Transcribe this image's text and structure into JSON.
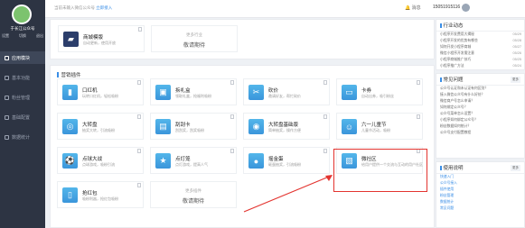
{
  "sidebar": {
    "brand": "于长江公众号",
    "settings": "设置",
    "switch": "切换",
    "exit": "退出",
    "items": [
      {
        "label": "应用模块",
        "active": true
      },
      {
        "label": "基本功能"
      },
      {
        "label": "粉丝管理"
      },
      {
        "label": "基础配置"
      },
      {
        "label": "数据统计"
      }
    ]
  },
  "topbar": {
    "tip": "当前未输入微信公众号",
    "tip_link": "立即接入",
    "bell": "消息",
    "phone": "15051915116"
  },
  "main": {
    "card_top": {
      "title": "商城模版",
      "desc": "自动更新，使用开放"
    },
    "more_top": {
      "line1": "更多行业",
      "line2": "敬请期待"
    },
    "section_title": "营销插件",
    "cards": [
      {
        "title": "口红机",
        "desc": "玩转口红机，轻松吸粉",
        "icon": "lipstick-icon",
        "glyph": "▮"
      },
      {
        "title": "拆礼盒",
        "desc": "领取礼盒，抢福利吸粉",
        "icon": "gift-icon",
        "glyph": "▣"
      },
      {
        "title": "砍价",
        "desc": "邀请好友，帮忙砍价",
        "icon": "bargain-icon",
        "glyph": "✂"
      },
      {
        "title": "卡券",
        "desc": "自动出券，吸引粉丝",
        "icon": "coupon-icon",
        "glyph": "▭"
      },
      {
        "title": "大转盘",
        "desc": "抽奖大转，引流吸粉",
        "icon": "wheel-icon",
        "glyph": "◎"
      },
      {
        "title": "刮刮卡",
        "desc": "刮刮奖，刮奖吸粉",
        "icon": "scratch-card-icon",
        "glyph": "▤"
      },
      {
        "title": "大转盘基础版",
        "desc": "简单抽奖，操作方便",
        "icon": "wheel-basic-icon",
        "glyph": "◉"
      },
      {
        "title": "六一儿童节",
        "desc": "儿童节活动，吸粉",
        "icon": "kids-day-icon",
        "glyph": "☺"
      },
      {
        "title": "点球大战",
        "desc": "点球游戏，吸粉引流",
        "icon": "football-icon",
        "glyph": "⚽"
      },
      {
        "title": "点灯笼",
        "desc": "点灯游戏，提高人气",
        "icon": "star-icon",
        "glyph": "★"
      },
      {
        "title": "摇金蛋",
        "desc": "砸蛋抽奖，引流吸粉",
        "icon": "egg-icon",
        "glyph": "●"
      },
      {
        "title": "微社区",
        "desc": "给用户提供一个交流与互动的用户社区",
        "icon": "community-icon",
        "glyph": "▧"
      },
      {
        "title": "抢红包",
        "desc": "吸粉利器，抢红包吸粉",
        "icon": "red-packet-icon",
        "glyph": "▯"
      }
    ],
    "more_bottom": {
      "line1": "更多插件",
      "line2": "敬请期待"
    }
  },
  "right": {
    "news": {
      "title": "行业动态",
      "items": [
        {
          "text": "小程序开发费用大揭秘",
          "date": "05/29"
        },
        {
          "text": "小程序开发的优势有哪些",
          "date": "05/28"
        },
        {
          "text": "如何开发小程序商城",
          "date": "05/27"
        },
        {
          "text": "微信小程序开发需注意",
          "date": "05/26"
        },
        {
          "text": "小程序商城推广技巧",
          "date": "05/25"
        },
        {
          "text": "小程序推广方法",
          "date": "05/24"
        }
      ]
    },
    "faq": {
      "title": "常见问题",
      "badge": "更多",
      "items": [
        {
          "text": "公众号认证和未认证有何区别？"
        },
        {
          "text": "接入微信公众号有什么好处？"
        },
        {
          "text": "微信商户号怎么申请？"
        },
        {
          "text": "如何绑定公众号？"
        },
        {
          "text": "公众号菜单怎么设置？"
        },
        {
          "text": "小程序如何绑定公众号？"
        },
        {
          "text": "粉丝数据如何统计？"
        },
        {
          "text": "公众号支付配置教程"
        }
      ]
    },
    "guide": {
      "title": "使用说明",
      "badge": "更多",
      "items": [
        {
          "text": "快速入门"
        },
        {
          "text": "公众号接入"
        },
        {
          "text": "插件使用"
        },
        {
          "text": "粉丝管理"
        },
        {
          "text": "数据统计"
        },
        {
          "text": "常见问题"
        }
      ]
    }
  }
}
